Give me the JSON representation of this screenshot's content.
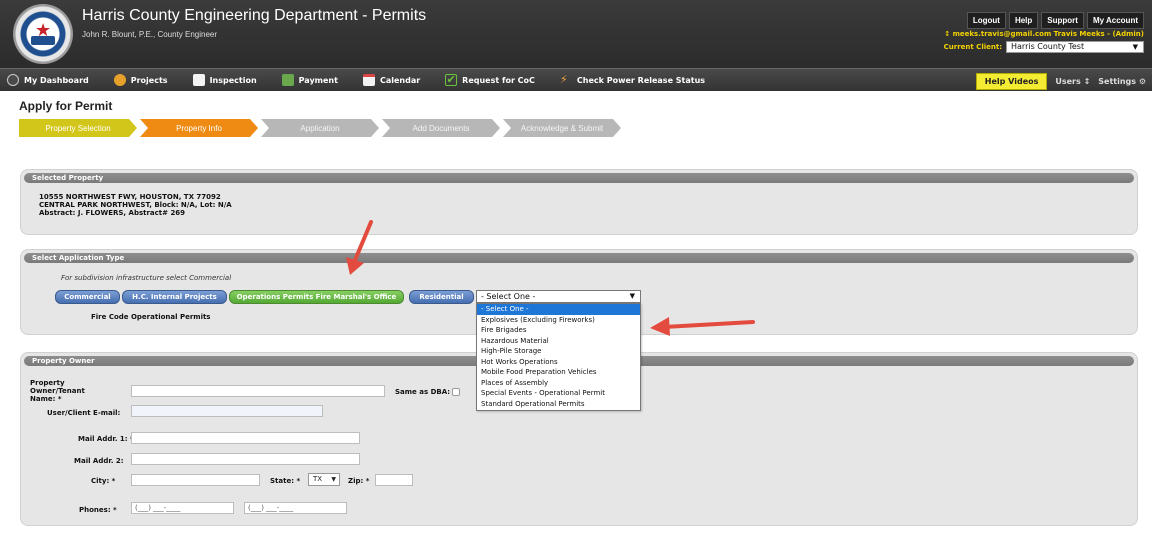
{
  "header": {
    "title": "Harris County Engineering Department - Permits",
    "subtitle": "John R. Blount, P.E., County Engineer",
    "top_links": [
      "Logout",
      "Help",
      "Support",
      "My Account"
    ],
    "user": "meeks.travis@gmail.com Travis Meeks - (Admin)",
    "client_label": "Current Client:",
    "client_value": "Harris County Test"
  },
  "nav": {
    "items": [
      "My Dashboard",
      "Projects",
      "Inspection",
      "Payment",
      "Calendar",
      "Request for CoC",
      "Check Power Release Status"
    ],
    "help_videos": "Help Videos",
    "users": "Users",
    "settings": "Settings"
  },
  "page": {
    "title": "Apply for Permit",
    "steps": [
      "Property Selection",
      "Property Info",
      "Application",
      "Add Documents",
      "Acknowledge & Submit"
    ]
  },
  "selected_property": {
    "heading": "Selected Property",
    "line1": "10555 NORTHWEST FWY, HOUSTON, TX 77092",
    "line2": "CENTRAL PARK NORTHWEST, Block: N/A, Lot: N/A",
    "line3": "Abstract: J. FLOWERS, Abstract# 269"
  },
  "application_type": {
    "heading": "Select Application Type",
    "hint": "For subdivision infrastructure select Commercial",
    "buttons": [
      "Commercial",
      "H.C. Internal Projects",
      "Operations Permits Fire Marshal's Office",
      "Residential"
    ],
    "subtype_label": "Fire Code Operational Permits",
    "select_value": "- Select One -",
    "options": [
      "- Select One -",
      "Explosives (Excluding Fireworks)",
      "Fire Brigades",
      "Hazardous Material",
      "High-Pile Storage",
      "Hot Works Operations",
      "Mobile Food Preparation Vehicles",
      "Places of Assembly",
      "Special Events - Operational Permit",
      "Standard Operational Permits"
    ]
  },
  "property_owner": {
    "heading": "Property Owner",
    "owner_label": "Property Owner/Tenant Name: *",
    "same_as_dba": "Same as DBA:",
    "email_label": "User/Client E-mail:",
    "mail1_label": "Mail Addr. 1: *",
    "mail2_label": "Mail Addr. 2:",
    "city_label": "City: *",
    "state_label": "State: *",
    "state_value": "TX",
    "zip_label": "Zip: *",
    "phones_label": "Phones: *",
    "phone_placeholder": "(___) ___-____"
  },
  "colors": {
    "step_active_1": "#d3c61a",
    "step_active_2": "#ef8a12",
    "button_blue": "#466fb0",
    "button_green": "#55a834",
    "annotation_arrow": "#e34b3e"
  }
}
